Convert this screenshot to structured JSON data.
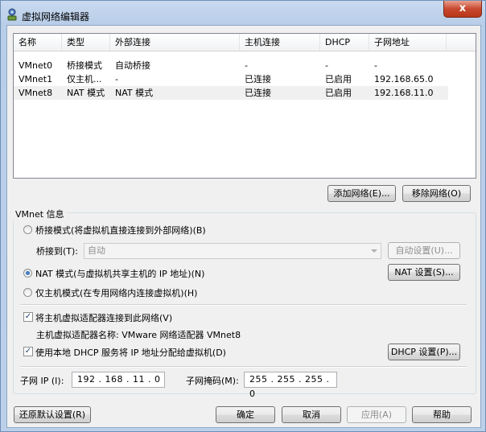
{
  "window": {
    "title": "虚拟网络编辑器",
    "close_label": "x"
  },
  "list": {
    "columns": [
      "名称",
      "类型",
      "外部连接",
      "主机连接",
      "DHCP",
      "子网地址"
    ],
    "rows": [
      [
        "VMnet0",
        "桥接模式",
        "自动桥接",
        "-",
        "-",
        "-"
      ],
      [
        "VMnet1",
        "仅主机...",
        "-",
        "已连接",
        "已启用",
        "192.168.65.0"
      ],
      [
        "VMnet8",
        "NAT 模式",
        "NAT 模式",
        "已连接",
        "已启用",
        "192.168.11.0"
      ]
    ]
  },
  "buttons": {
    "add_network": "添加网络(E)...",
    "remove_network": "移除网络(O)",
    "auto_settings": "自动设置(U)...",
    "nat_settings": "NAT 设置(S)...",
    "dhcp_settings": "DHCP 设置(P)...",
    "restore_defaults": "还原默认设置(R)",
    "ok": "确定",
    "cancel": "取消",
    "apply": "应用(A)",
    "help": "帮助"
  },
  "vmnet_info": {
    "group_label": "VMnet 信息",
    "bridged_label": "桥接模式(将虚拟机直接连接到外部网络)(B)",
    "bridged_to_label": "桥接到(T):",
    "bridged_to_value": "自动",
    "nat_label": "NAT 模式(与虚拟机共享主机的 IP 地址)(N)",
    "hostonly_label": "仅主机模式(在专用网络内连接虚拟机)(H)",
    "connect_adapter_label": "将主机虚拟适配器连接到此网络(V)",
    "adapter_name_label": "主机虚拟适配器名称: VMware 网络适配器 VMnet8",
    "use_dhcp_label": "使用本地 DHCP 服务将 IP 地址分配给虚拟机(D)",
    "subnet_ip_label": "子网 IP (I):",
    "subnet_ip_value": "192 . 168 . 11 . 0",
    "subnet_mask_label": "子网掩码(M):",
    "subnet_mask_value": "255 . 255 . 255 . 0",
    "selected_mode": "nat",
    "connect_adapter_checked": true,
    "use_dhcp_checked": true,
    "check_glyph": "✓"
  }
}
